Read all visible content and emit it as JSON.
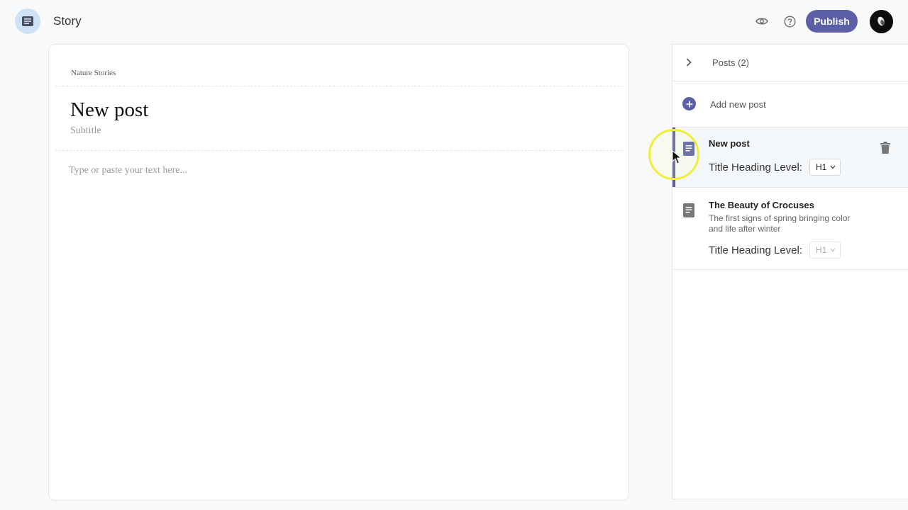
{
  "app": {
    "title": "Story",
    "menu_icon": "document-list-icon",
    "preview_icon": "eye-icon",
    "help_icon": "help-circle-icon",
    "publish_label": "Publish",
    "accent_color": "#5a5fa6"
  },
  "editor": {
    "publication_name": "Nature Stories",
    "title": "New post",
    "subtitle_placeholder": "Subtitle",
    "body_placeholder": "Type or paste your text here..."
  },
  "panel": {
    "posts_header": "Posts (2)",
    "add_new_label": "Add new post",
    "posts": [
      {
        "title": "New post",
        "subtitle": "",
        "heading_level_label": "Title Heading Level:",
        "heading_level": "H1",
        "active": true
      },
      {
        "title": "The Beauty of Crocuses",
        "subtitle": "The first signs of spring bringing color and life after winter",
        "heading_level_label": "Title Heading Level:",
        "heading_level": "H1",
        "active": false
      }
    ]
  }
}
